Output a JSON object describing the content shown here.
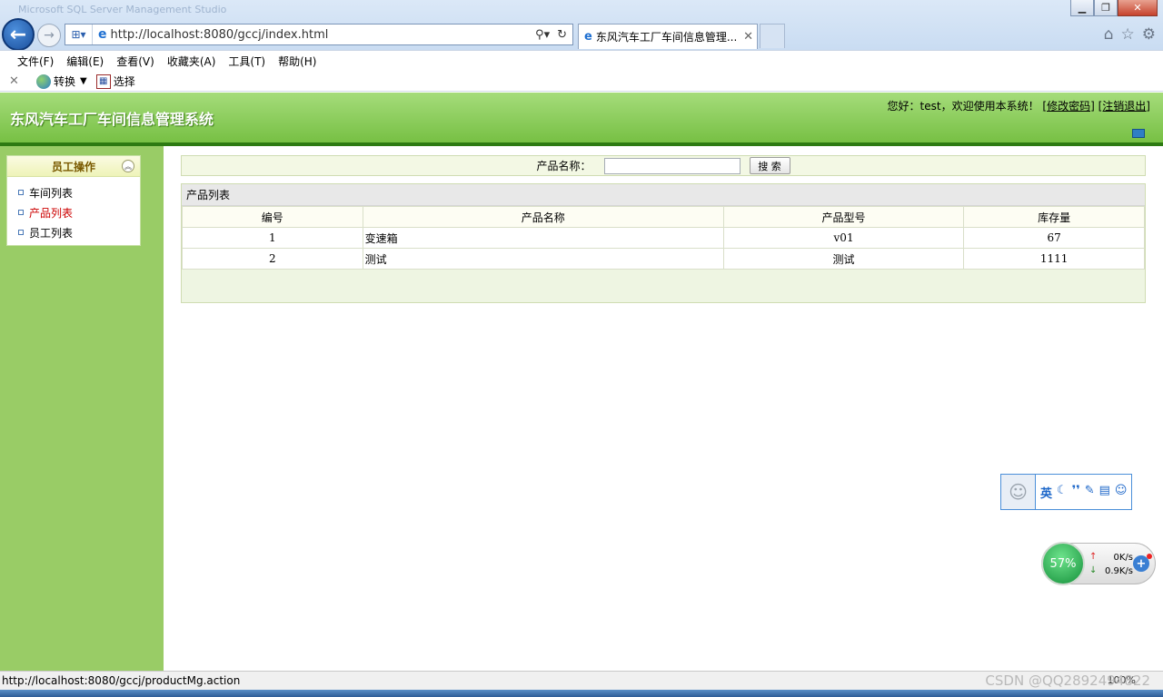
{
  "browser": {
    "window_title": "Microsoft SQL Server Management Studio",
    "address_url": "http://localhost:8080/gccj/index.html",
    "tab_title": "东风汽车工厂车间信息管理...",
    "menu": [
      "文件(F)",
      "编辑(E)",
      "查看(V)",
      "收藏夹(A)",
      "工具(T)",
      "帮助(H)"
    ],
    "command_bar": {
      "convert_label": "转换",
      "select_label": "选择"
    },
    "icons": [
      "back-icon",
      "forward-icon",
      "ie-icon",
      "search-icon",
      "refresh-icon",
      "home-icon",
      "star-icon",
      "gear-icon"
    ]
  },
  "site": {
    "title": "东风汽车工厂车间信息管理系统",
    "greeting": "您好：test，欢迎使用本系统！",
    "change_password": "[修改密码]",
    "logout": "[注销退出]"
  },
  "sidebar": {
    "panel_title": "员工操作",
    "items": [
      {
        "label": "车间列表",
        "active": false
      },
      {
        "label": "产品列表",
        "active": true
      },
      {
        "label": "员工列表",
        "active": false
      }
    ]
  },
  "search": {
    "label": "产品名称：",
    "value": "",
    "button": "搜 索"
  },
  "product_list": {
    "title": "产品列表",
    "columns": [
      "编号",
      "产品名称",
      "产品型号",
      "库存量"
    ],
    "rows": [
      [
        "1",
        "变速箱",
        "v01",
        "67"
      ],
      [
        "2",
        "测试",
        "测试",
        "1111"
      ]
    ]
  },
  "qq_toolbar": {
    "lang": "英"
  },
  "net_monitor": {
    "percent": "57%",
    "upload": "0K/s",
    "download": "0.9K/s"
  },
  "statusbar": {
    "url": "http://localhost:8080/gccj/productMg.action",
    "zoom": "100%"
  },
  "watermark": "CSDN @QQ2892494822",
  "colors": {
    "header_green": "#77c044",
    "sidebar_green": "#99cc66",
    "active_link": "#cc0000"
  }
}
